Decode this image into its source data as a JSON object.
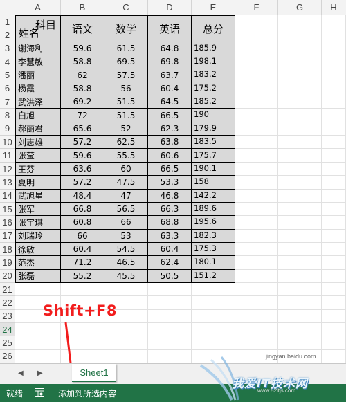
{
  "columns": [
    "A",
    "B",
    "C",
    "D",
    "E",
    "F",
    "G",
    "H"
  ],
  "rows": [
    "1",
    "2",
    "3",
    "4",
    "5",
    "6",
    "7",
    "8",
    "9",
    "10",
    "11",
    "12",
    "13",
    "14",
    "15",
    "16",
    "17",
    "18",
    "19",
    "20",
    "21",
    "22",
    "23",
    "24",
    "25",
    "26"
  ],
  "header_cell": {
    "subject": "科目",
    "name": "姓名"
  },
  "headers": [
    "语文",
    "数学",
    "英语",
    "总分"
  ],
  "records": [
    [
      "谢海利",
      "59.6",
      "61.5",
      "64.8",
      "185.9"
    ],
    [
      "李慧敏",
      "58.8",
      "69.5",
      "69.8",
      "198.1"
    ],
    [
      "潘丽",
      "62",
      "57.5",
      "63.7",
      "183.2"
    ],
    [
      "杨霞",
      "58.8",
      "56",
      "60.4",
      "175.2"
    ],
    [
      "武洪泽",
      "69.2",
      "51.5",
      "64.5",
      "185.2"
    ],
    [
      "白旭",
      "72",
      "51.5",
      "66.5",
      "190"
    ],
    [
      "郝丽君",
      "65.6",
      "52",
      "62.3",
      "179.9"
    ],
    [
      "刘志雄",
      "57.2",
      "62.5",
      "63.8",
      "183.5"
    ],
    [
      "张莹",
      "59.6",
      "55.5",
      "60.6",
      "175.7"
    ],
    [
      "王芬",
      "63.6",
      "60",
      "66.5",
      "190.1"
    ],
    [
      "夏明",
      "57.2",
      "47.5",
      "53.3",
      "158"
    ],
    [
      "武旭星",
      "48.4",
      "47",
      "46.8",
      "142.2"
    ],
    [
      "张军",
      "66.8",
      "56.5",
      "66.3",
      "189.6"
    ],
    [
      "张宇琪",
      "60.8",
      "66",
      "68.8",
      "195.6"
    ],
    [
      "刘瑞玲",
      "66",
      "53",
      "63.3",
      "182.3"
    ],
    [
      "徐敏",
      "60.4",
      "54.5",
      "60.4",
      "175.3"
    ],
    [
      "范杰",
      "71.2",
      "46.5",
      "62.4",
      "180.1"
    ],
    [
      "张磊",
      "55.2",
      "45.5",
      "50.5",
      "151.2"
    ]
  ],
  "annotation": {
    "shortcut": "Shift+F8",
    "color": "#f21d1d"
  },
  "sheet_tab": "Sheet1",
  "nav": {
    "prev": "◀",
    "next": "▶"
  },
  "status": {
    "ready": "就绪",
    "mode": "添加到所选内容",
    "macro_icon": "macro-record-icon",
    "color": "#217346"
  },
  "credit": "jingyan.baidu.com",
  "watermark": {
    "text": "我爱IT技术网",
    "site": "www.52itjs.com"
  }
}
